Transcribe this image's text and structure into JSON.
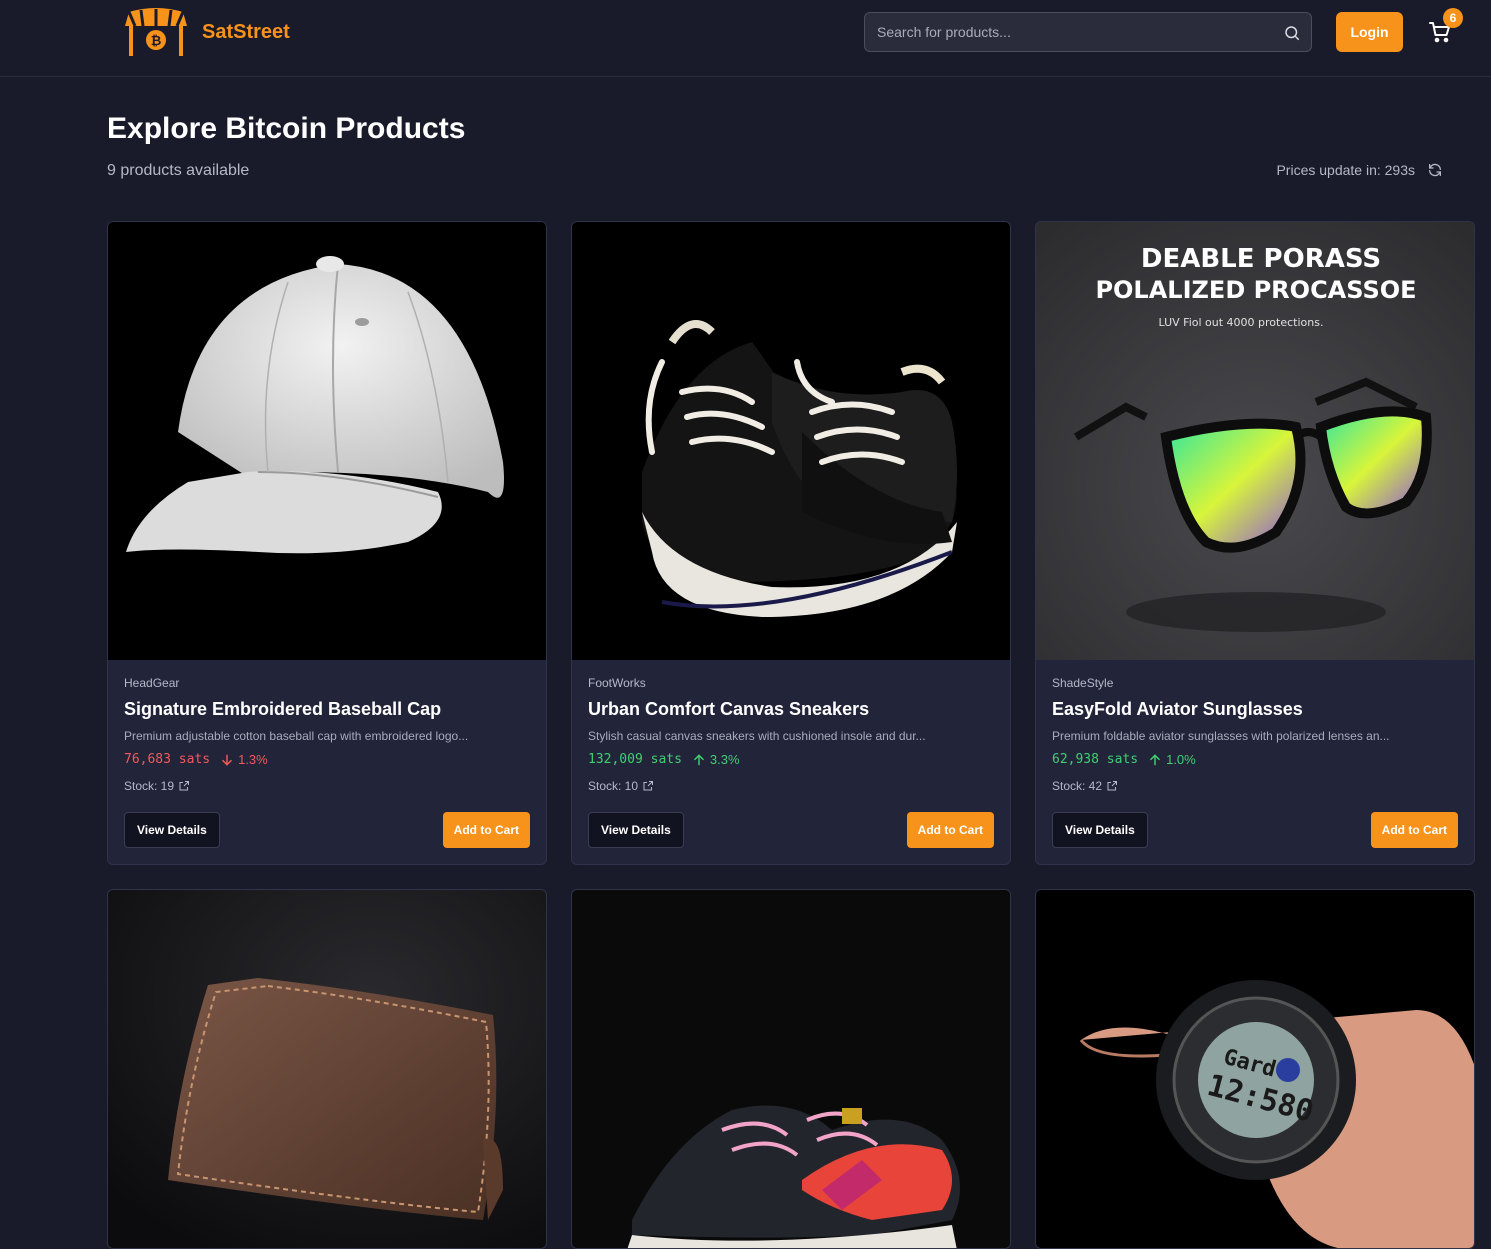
{
  "header": {
    "brand": "SatStreet",
    "search_placeholder": "Search for products...",
    "login_label": "Login",
    "cart_count": "6"
  },
  "main": {
    "title": "Explore Bitcoin Products",
    "count_text": "9 products available",
    "price_update_text": "Prices update in: 293s"
  },
  "products": [
    {
      "brand": "HeadGear",
      "name": "Signature Embroidered Baseball Cap",
      "description": "Premium adjustable cotton baseball cap with embroidered logo...",
      "price": "76,683 sats",
      "change": "1.3%",
      "trend": "down",
      "stock": "Stock: 19",
      "view_label": "View Details",
      "cart_label": "Add to Cart"
    },
    {
      "brand": "FootWorks",
      "name": "Urban Comfort Canvas Sneakers",
      "description": "Stylish casual canvas sneakers with cushioned insole and dur...",
      "price": "132,009 sats",
      "change": "3.3%",
      "trend": "up",
      "stock": "Stock: 10",
      "view_label": "View Details",
      "cart_label": "Add to Cart"
    },
    {
      "brand": "ShadeStyle",
      "name": "EasyFold Aviator Sunglasses",
      "description": "Premium foldable aviator sunglasses with polarized lenses an...",
      "price": "62,938 sats",
      "change": "1.0%",
      "trend": "up",
      "stock": "Stock: 42",
      "view_label": "View Details",
      "cart_label": "Add to Cart",
      "image_text_1": "DEABLE PORASS",
      "image_text_2": "POLALIZED PROCASSOE",
      "image_text_3": "LUV Fiol out 4000 protections."
    }
  ],
  "colors": {
    "accent": "#f7931a",
    "background": "#1a1b2a",
    "card": "#22243a",
    "down": "#f05a5a",
    "up": "#3fcf72"
  },
  "icons": [
    "storefront-bitcoin-logo",
    "search-icon",
    "shopping-cart-icon",
    "refresh-icon",
    "external-link-icon",
    "arrow-down-icon",
    "arrow-up-icon"
  ]
}
